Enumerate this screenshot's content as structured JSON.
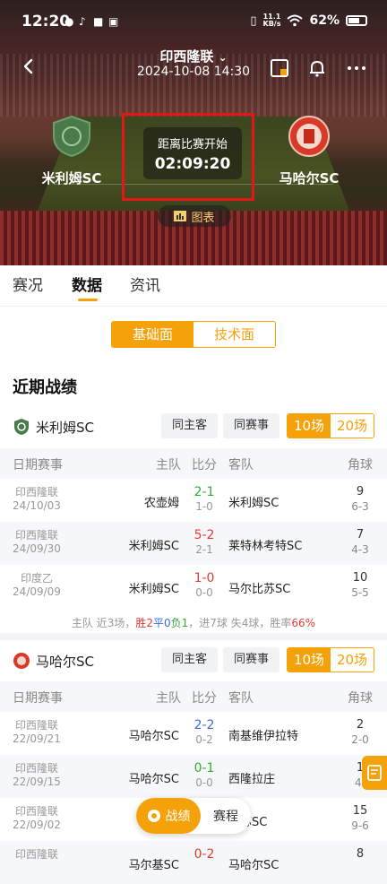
{
  "status_bar": {
    "time": "12:20",
    "net_speed": "11.1",
    "net_unit": "KB/s",
    "battery": "62%"
  },
  "header": {
    "league": "印西隆联",
    "datetime": "2024-10-08 14:30"
  },
  "match": {
    "home_team": "米利姆SC",
    "away_team": "马哈尔SC",
    "countdown_label": "距离比赛开始",
    "countdown": "02:09:20",
    "chart_button": "图表"
  },
  "tabs": [
    "赛况",
    "数据",
    "资讯"
  ],
  "sub_tabs": [
    "基础面",
    "技术面"
  ],
  "section_title": "近期战绩",
  "filters": {
    "same_venue": "同主客",
    "same_league": "同赛事",
    "count_10": "10场",
    "count_20": "20场"
  },
  "table_headers": {
    "league": "日期赛事",
    "home": "主队",
    "score": "比分",
    "away": "客队",
    "corner": "角球"
  },
  "team1": {
    "name": "米利姆SC",
    "rows": [
      {
        "league": "印西隆联",
        "date": "24/10/03",
        "home": "农壶姆",
        "score": "2-1",
        "ht": "1-0",
        "away": "米利姆SC",
        "corner": "9",
        "corner_ht": "6-3"
      },
      {
        "league": "印西隆联",
        "date": "24/09/30",
        "home": "米利姆SC",
        "score": "5-2",
        "ht": "2-1",
        "away": "莱特林考特SC",
        "corner": "7",
        "corner_ht": "4-3"
      },
      {
        "league": "印度乙",
        "date": "24/09/09",
        "home": "米利姆SC",
        "score": "1-0",
        "ht": "0-0",
        "away": "马尔比苏SC",
        "corner": "10",
        "corner_ht": "5-5"
      }
    ],
    "summary": {
      "prefix": "主队 近3场，",
      "w": "胜2",
      "d": "平0",
      "l": "负1",
      "mid": "，进7球 失4球，胜率",
      "rate": "66%"
    }
  },
  "team2": {
    "name": "马哈尔SC",
    "rows": [
      {
        "league": "印西隆联",
        "date": "22/09/21",
        "home": "马哈尔SC",
        "score": "2-2",
        "ht": "0-2",
        "away": "南基维伊拉特",
        "corner": "2",
        "corner_ht": "2-0"
      },
      {
        "league": "印西隆联",
        "date": "22/09/15",
        "home": "马哈尔SC",
        "score": "0-1",
        "ht": "0-0",
        "away": "西隆拉庄",
        "corner": "1",
        "corner_ht": "4-"
      },
      {
        "league": "印西隆联",
        "date": "22/09/02",
        "home": "i",
        "score": "",
        "ht": "",
        "away": "尔苏SC",
        "corner": "15",
        "corner_ht": "9-6"
      },
      {
        "league": "印西隆联",
        "date": "",
        "home": "马尔基SC",
        "score": "0-2",
        "ht": "",
        "away": "马哈尔SC",
        "corner": "8",
        "corner_ht": ""
      }
    ]
  },
  "float_bar": {
    "active": "战绩",
    "inactive": "赛程"
  },
  "colors": {
    "accent": "#f5a10a",
    "win": "#36a83a",
    "loss": "#e43a33",
    "draw": "#3a6ee0"
  }
}
